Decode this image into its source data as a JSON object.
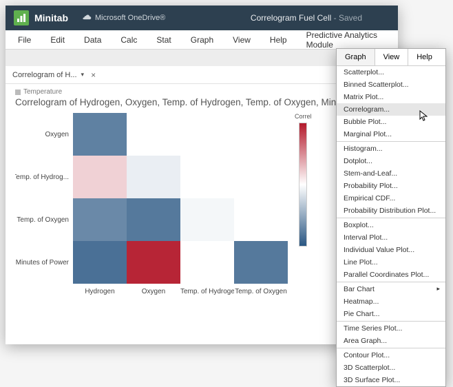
{
  "titlebar": {
    "brand": "Minitab",
    "onedrive": "Microsoft OneDrive®",
    "doc": "Correlogram Fuel Cell",
    "saved": "- Saved"
  },
  "menubar": [
    "File",
    "Edit",
    "Data",
    "Calc",
    "Stat",
    "Graph",
    "View",
    "Help",
    "Predictive Analytics Module"
  ],
  "tab": {
    "label": "Correlogram of H...",
    "close": "×"
  },
  "crumb": "Temperature",
  "chart_title": "Correlogram of Hydrogen, Oxygen, Temp. of Hydrogen, Temp. of Oxygen, Minutes of P",
  "dropdown_menubar": [
    "Graph",
    "View",
    "Help"
  ],
  "dropdown_items": [
    {
      "t": "item",
      "l": "Scatterplot..."
    },
    {
      "t": "item",
      "l": "Binned Scatterplot..."
    },
    {
      "t": "item",
      "l": "Matrix Plot..."
    },
    {
      "t": "item",
      "l": "Correlogram...",
      "hover": true
    },
    {
      "t": "item",
      "l": "Bubble Plot..."
    },
    {
      "t": "item",
      "l": "Marginal Plot..."
    },
    {
      "t": "sep"
    },
    {
      "t": "item",
      "l": "Histogram..."
    },
    {
      "t": "item",
      "l": "Dotplot..."
    },
    {
      "t": "item",
      "l": "Stem-and-Leaf..."
    },
    {
      "t": "item",
      "l": "Probability Plot..."
    },
    {
      "t": "item",
      "l": "Empirical CDF..."
    },
    {
      "t": "item",
      "l": "Probability Distribution Plot..."
    },
    {
      "t": "sep"
    },
    {
      "t": "item",
      "l": "Boxplot..."
    },
    {
      "t": "item",
      "l": "Interval Plot..."
    },
    {
      "t": "item",
      "l": "Individual Value Plot..."
    },
    {
      "t": "item",
      "l": "Line Plot..."
    },
    {
      "t": "item",
      "l": "Parallel Coordinates Plot..."
    },
    {
      "t": "sep"
    },
    {
      "t": "item",
      "l": "Bar Chart",
      "sub": true
    },
    {
      "t": "item",
      "l": "Heatmap..."
    },
    {
      "t": "item",
      "l": "Pie Chart..."
    },
    {
      "t": "sep"
    },
    {
      "t": "item",
      "l": "Time Series Plot..."
    },
    {
      "t": "item",
      "l": "Area Graph..."
    },
    {
      "t": "sep"
    },
    {
      "t": "item",
      "l": "Contour Plot..."
    },
    {
      "t": "item",
      "l": "3D Scatterplot..."
    },
    {
      "t": "item",
      "l": "3D Surface Plot..."
    }
  ],
  "chart_data": {
    "type": "heatmap",
    "title": "Correlogram of Hydrogen, Oxygen, Temp. of Hydrogen, Temp. of Oxygen, Minutes of Power",
    "legend_label": "Correl",
    "x": [
      "Hydrogen",
      "Oxygen",
      "Temp. of Hydrogen",
      "Temp. of Oxygen"
    ],
    "y": [
      "Oxygen",
      "Temp. of Hydrog...",
      "Temp. of Oxygen",
      "Minutes of Power"
    ],
    "values": [
      [
        -0.75,
        null,
        null,
        null
      ],
      [
        0.2,
        -0.1,
        null,
        null
      ],
      [
        -0.7,
        -0.8,
        -0.05,
        null
      ],
      [
        -0.85,
        0.95,
        null,
        -0.8
      ]
    ],
    "colorscale": {
      "min": -1,
      "min_color": "#2a5783",
      "mid": 0,
      "mid_color": "#ffffff",
      "max": 1,
      "max_color": "#b3192b"
    }
  }
}
